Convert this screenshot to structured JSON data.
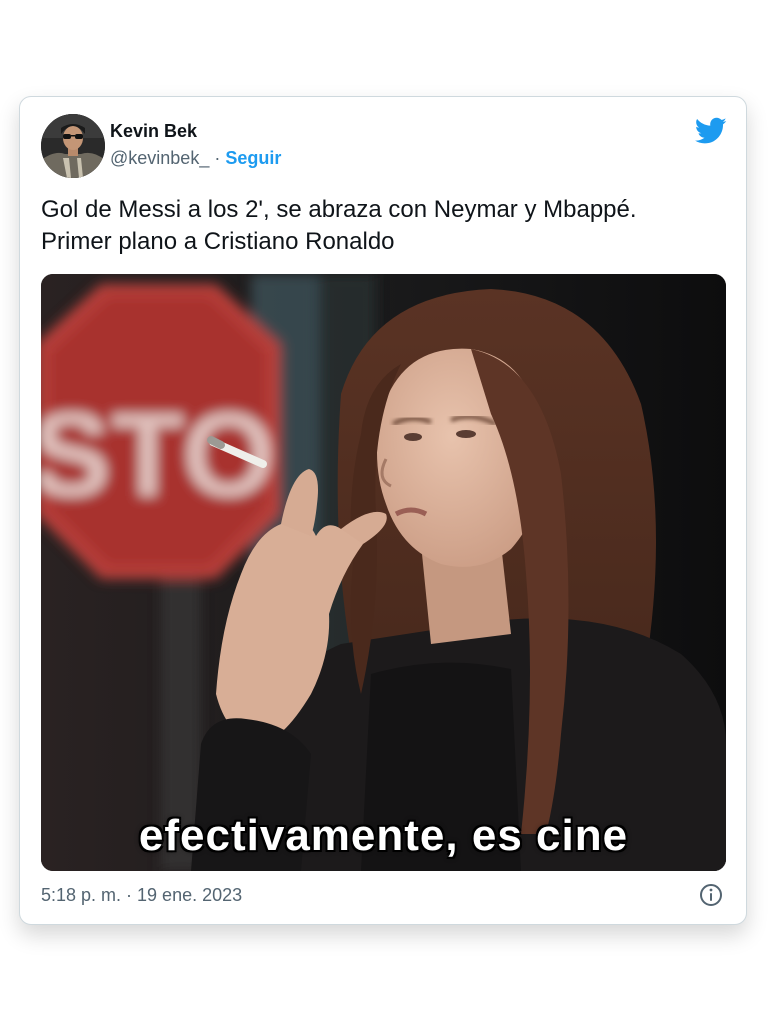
{
  "tweet": {
    "author": {
      "display_name": "Kevin Bek",
      "handle": "@kevinbek_",
      "separator": "·",
      "follow_label": "Seguir"
    },
    "text_lines": [
      "Gol de Messi a los 2', se abraza con Neymar y Mbappé.",
      "Primer plano a Cristiano Ronaldo"
    ],
    "media": {
      "caption": "efectivamente, es cine",
      "sign_text": "STO"
    },
    "timestamp": "5:18 p. m. · 19 ene. 2023",
    "icons": {
      "platform": "twitter-bird-icon",
      "info": "info-icon"
    },
    "colors": {
      "accent": "#1d9bf0",
      "text_primary": "#0f1419",
      "text_secondary": "#536471",
      "border": "#cfd9de"
    }
  }
}
